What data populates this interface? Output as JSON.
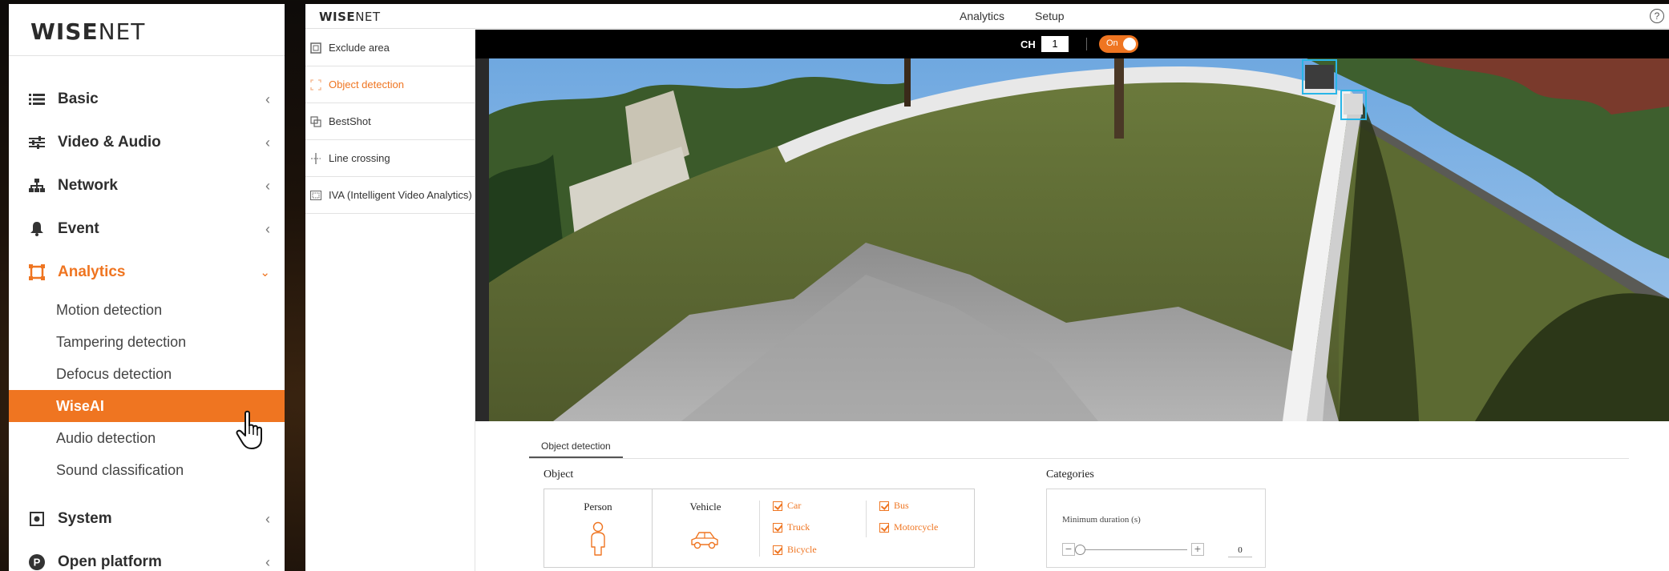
{
  "sidebar": {
    "logo": {
      "bold": "WISE",
      "light": "NET"
    },
    "groups": [
      {
        "label": "Basic",
        "icon": "list-icon"
      },
      {
        "label": "Video & Audio",
        "icon": "sliders-icon"
      },
      {
        "label": "Network",
        "icon": "network-icon"
      },
      {
        "label": "Event",
        "icon": "bell-icon"
      },
      {
        "label": "Analytics",
        "icon": "analytics-icon"
      },
      {
        "label": "System",
        "icon": "system-icon"
      },
      {
        "label": "Open platform",
        "icon": "open-platform-icon"
      }
    ],
    "analytics_items": [
      {
        "label": "Motion detection"
      },
      {
        "label": "Tampering detection"
      },
      {
        "label": "Defocus detection"
      },
      {
        "label": "WiseAI"
      },
      {
        "label": "Audio detection"
      },
      {
        "label": "Sound classification"
      }
    ],
    "selected_item": "WiseAI",
    "accent_color": "#ef7521"
  },
  "topbar": {
    "logo": {
      "bold": "WISE",
      "light": "NET"
    },
    "nav": [
      {
        "label": "Analytics"
      },
      {
        "label": "Setup"
      }
    ],
    "help": "?"
  },
  "subnav": {
    "items": [
      {
        "label": "Exclude area",
        "icon": "exclude-area-icon"
      },
      {
        "label": "Object detection",
        "icon": "object-detection-icon"
      },
      {
        "label": "BestShot",
        "icon": "bestshot-icon"
      },
      {
        "label": "Line crossing",
        "icon": "line-crossing-icon"
      },
      {
        "label": "IVA (Intelligent Video Analytics)",
        "icon": "iva-icon"
      }
    ],
    "active": "Object detection"
  },
  "video": {
    "ch_label": "CH",
    "ch_value": "1",
    "toggle_label": "On",
    "bbox_color": "#29b6e8"
  },
  "settings": {
    "tab": "Object detection",
    "object_title": "Object",
    "person_label": "Person",
    "vehicle_label": "Vehicle",
    "vehicle_types": [
      {
        "label": "Car",
        "checked": true
      },
      {
        "label": "Truck",
        "checked": true
      },
      {
        "label": "Bicycle",
        "checked": true
      },
      {
        "label": "Bus",
        "checked": true
      },
      {
        "label": "Motorcycle",
        "checked": true
      }
    ],
    "categories_title": "Categories",
    "min_duration_label": "Minimum duration (s)",
    "min_duration_value": "0",
    "minus": "−",
    "plus": "+"
  }
}
